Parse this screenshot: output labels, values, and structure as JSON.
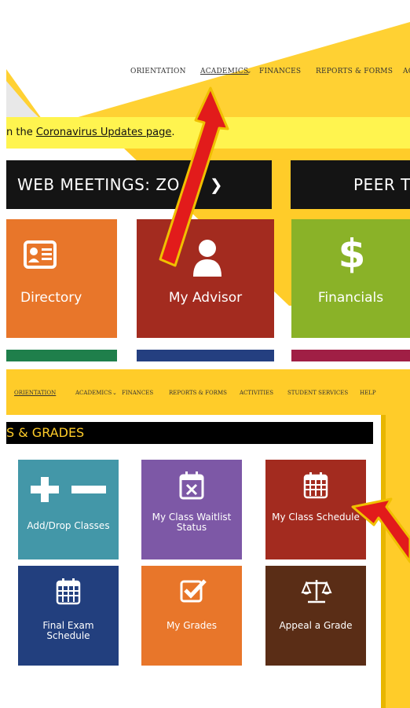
{
  "panel1": {
    "nav": {
      "orientation": "ORIENTATION",
      "academics": "ACADEMICS",
      "finances": "FINANCES",
      "reports_forms": "REPORTS & FORMS",
      "cut_item": "AC"
    },
    "banner": {
      "prefix": "n the ",
      "link": "Coronavirus Updates page",
      "suffix": "."
    },
    "bars": {
      "web_meetings": "WEB MEETINGS: ZO",
      "web_meetings_tail": "M",
      "peer": "PEER T"
    },
    "tiles": [
      {
        "label": "Directory",
        "color": "#e8762a",
        "icon": "id-card-icon"
      },
      {
        "label": "My Advisor",
        "color": "#a32b1f",
        "icon": "user-icon"
      },
      {
        "label": "Financials",
        "color": "#8ab228",
        "icon": "dollar-icon"
      }
    ],
    "bottom_strip_colors": [
      "#1f7f4b",
      "#243f80",
      "#a01f45"
    ]
  },
  "panel2": {
    "nav": {
      "orientation": "ORIENTATION",
      "academics": "ACADEMICS",
      "finances": "FINANCES",
      "reports_forms": "REPORTS & FORMS",
      "activities": "ACTIVITIES",
      "student_services": "STUDENT SERVICES",
      "help": "HELP"
    },
    "heading": "S & GRADES",
    "tiles": [
      {
        "label": "Add/Drop Classes",
        "color": "#4397a8",
        "icon": "plus-minus-icon"
      },
      {
        "label": "My Class Waitlist Status",
        "color": "#7d58a6",
        "icon": "calendar-x-icon"
      },
      {
        "label": "My Class Schedule",
        "color": "#a32b1f",
        "icon": "calendar-grid-icon"
      },
      {
        "label": "Final Exam Schedule",
        "color": "#223f7e",
        "icon": "calendar-grid-icon"
      },
      {
        "label": "My Grades",
        "color": "#e8762a",
        "icon": "checkbox-icon"
      },
      {
        "label": "Appeal a Grade",
        "color": "#5a2d16",
        "icon": "scales-icon"
      }
    ]
  },
  "annotation": {
    "arrow_color": "#e21b1b",
    "arrow_outline": "#f0c000"
  }
}
